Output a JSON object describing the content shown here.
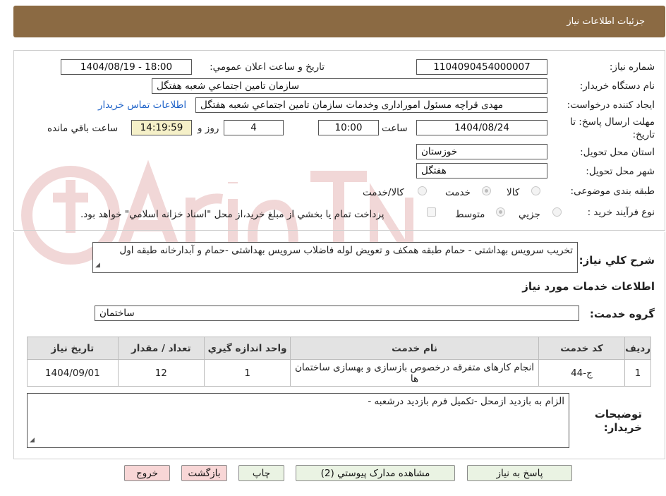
{
  "header": {
    "title": "جزئیات اطلاعات نیاز"
  },
  "form": {
    "need_number_label": "شماره نیاز:",
    "need_number": "1104090454000007",
    "announce_label": "تاریخ و ساعت اعلان عمومي:",
    "announce_value": "1404/08/19 - 18:00",
    "buyer_org_label": "نام دستگاه خريدار:",
    "buyer_org": "سازمان تامين اجتماعي شعبه هفتگل",
    "requester_label": "ايجاد کننده درخواست:",
    "requester": "مهدی قراچه مسئول امورادارى وخدمات سازمان تامين اجتماعي شعبه هفتگل",
    "contact_link": "اطلاعات تماس خريدار",
    "deadline_label_1": "مهلت ارسال پاسخ: تا",
    "deadline_label_2": "تاريخ:",
    "deadline_date": "1404/08/24",
    "time_word": "ساعت",
    "deadline_time": "10:00",
    "days_value": "4",
    "days_and": "روز و",
    "remaining_time": "14:19:59",
    "remaining_label": "ساعت باقي مانده",
    "province_label": "استان محل تحويل:",
    "province": "خوزستان",
    "city_label": "شهر محل تحويل:",
    "city": "هفتگل",
    "category_label": "طبقه بندی موضوعی:",
    "category_options": [
      "کالا",
      "خدمت",
      "کالا/خدمت"
    ],
    "category_selected": "خدمت",
    "process_label": "نوع فرآيند خريد :",
    "process_options": [
      "جزيي",
      "متوسط"
    ],
    "process_selected": "متوسط",
    "payment_note": "پرداخت تمام يا بخشي از مبلغ خريد،از محل \"اسناد خزانه اسلامي\" خواهد بود."
  },
  "summary": {
    "label": "شرح کلي نياز:",
    "text": "تخریب سرویس بهداشتی - حمام  طبقه همکف و تعویض لوله فاضلاب سرویس بهداشتی -حمام و آبدارخانه طبقه اول"
  },
  "services": {
    "section_title": "اطلاعات خدمات مورد نياز",
    "group_label": "گروه خدمت:",
    "group_value": "ساختمان",
    "columns": [
      "رديف",
      "کد خدمت",
      "نام خدمت",
      "واحد اندازه گيري",
      "تعداد / مقدار",
      "تاريخ نياز"
    ],
    "rows": [
      {
        "row": "1",
        "code": "ج-44",
        "name": "انجام کارهای متفرقه درخصوص بازسازی و بهسازی ساختمان ها",
        "unit": "1",
        "qty": "12",
        "date": "1404/09/01"
      }
    ]
  },
  "buyer_notes": {
    "label_1": "توضيحات",
    "label_2": "خريدار:",
    "text": "الزام به بازدید ازمحل -تکمیل فرم بازدید درشعبه -"
  },
  "buttons": {
    "reply": "پاسخ به نياز",
    "attachments": "مشاهده مدارک پيوستي (2)",
    "print": "چاپ",
    "back": "بازگشت",
    "exit": "خروج"
  },
  "colors": {
    "header_bg": "#8b6a43",
    "link": "#1e62c8",
    "button_green": "#eaf3e3",
    "button_pink": "#f8d6d6",
    "time_highlight": "#f5f0c8"
  }
}
